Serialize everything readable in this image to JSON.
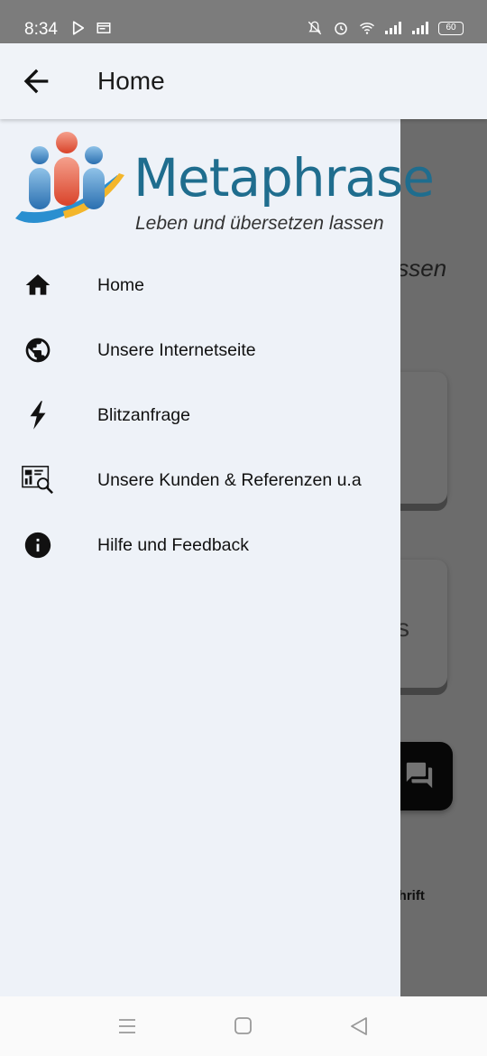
{
  "status_bar": {
    "time": "8:34",
    "battery": "60",
    "icons": [
      "play-store-icon",
      "news-icon",
      "mute-icon",
      "alarm-icon",
      "wifi-icon",
      "signal-icon",
      "signal-icon",
      "battery-icon"
    ]
  },
  "app_bar": {
    "title": "Home"
  },
  "drawer": {
    "logo": {
      "wordmark": "Metaphrase",
      "tagline": "Leben und übersetzen lassen"
    },
    "items": [
      {
        "label": "Home",
        "icon": "home-icon"
      },
      {
        "label": "Unsere Internetseite",
        "icon": "globe-icon"
      },
      {
        "label": "Blitzanfrage",
        "icon": "lightning-icon"
      },
      {
        "label": "Unsere Kunden & Referenzen u.a",
        "icon": "analytics-icon"
      },
      {
        "label": "Hilfe und Feedback",
        "icon": "info-icon"
      }
    ]
  },
  "background": {
    "logo_partial": "ase",
    "tagline_partial": "lassen",
    "card_partial": "s",
    "bottom_text_partial": "tschrift"
  },
  "colors": {
    "drawer_bg": "#eef2f8",
    "brand_blue": "#1f6d8e",
    "scrim": "rgba(0,0,0,0.55)"
  }
}
